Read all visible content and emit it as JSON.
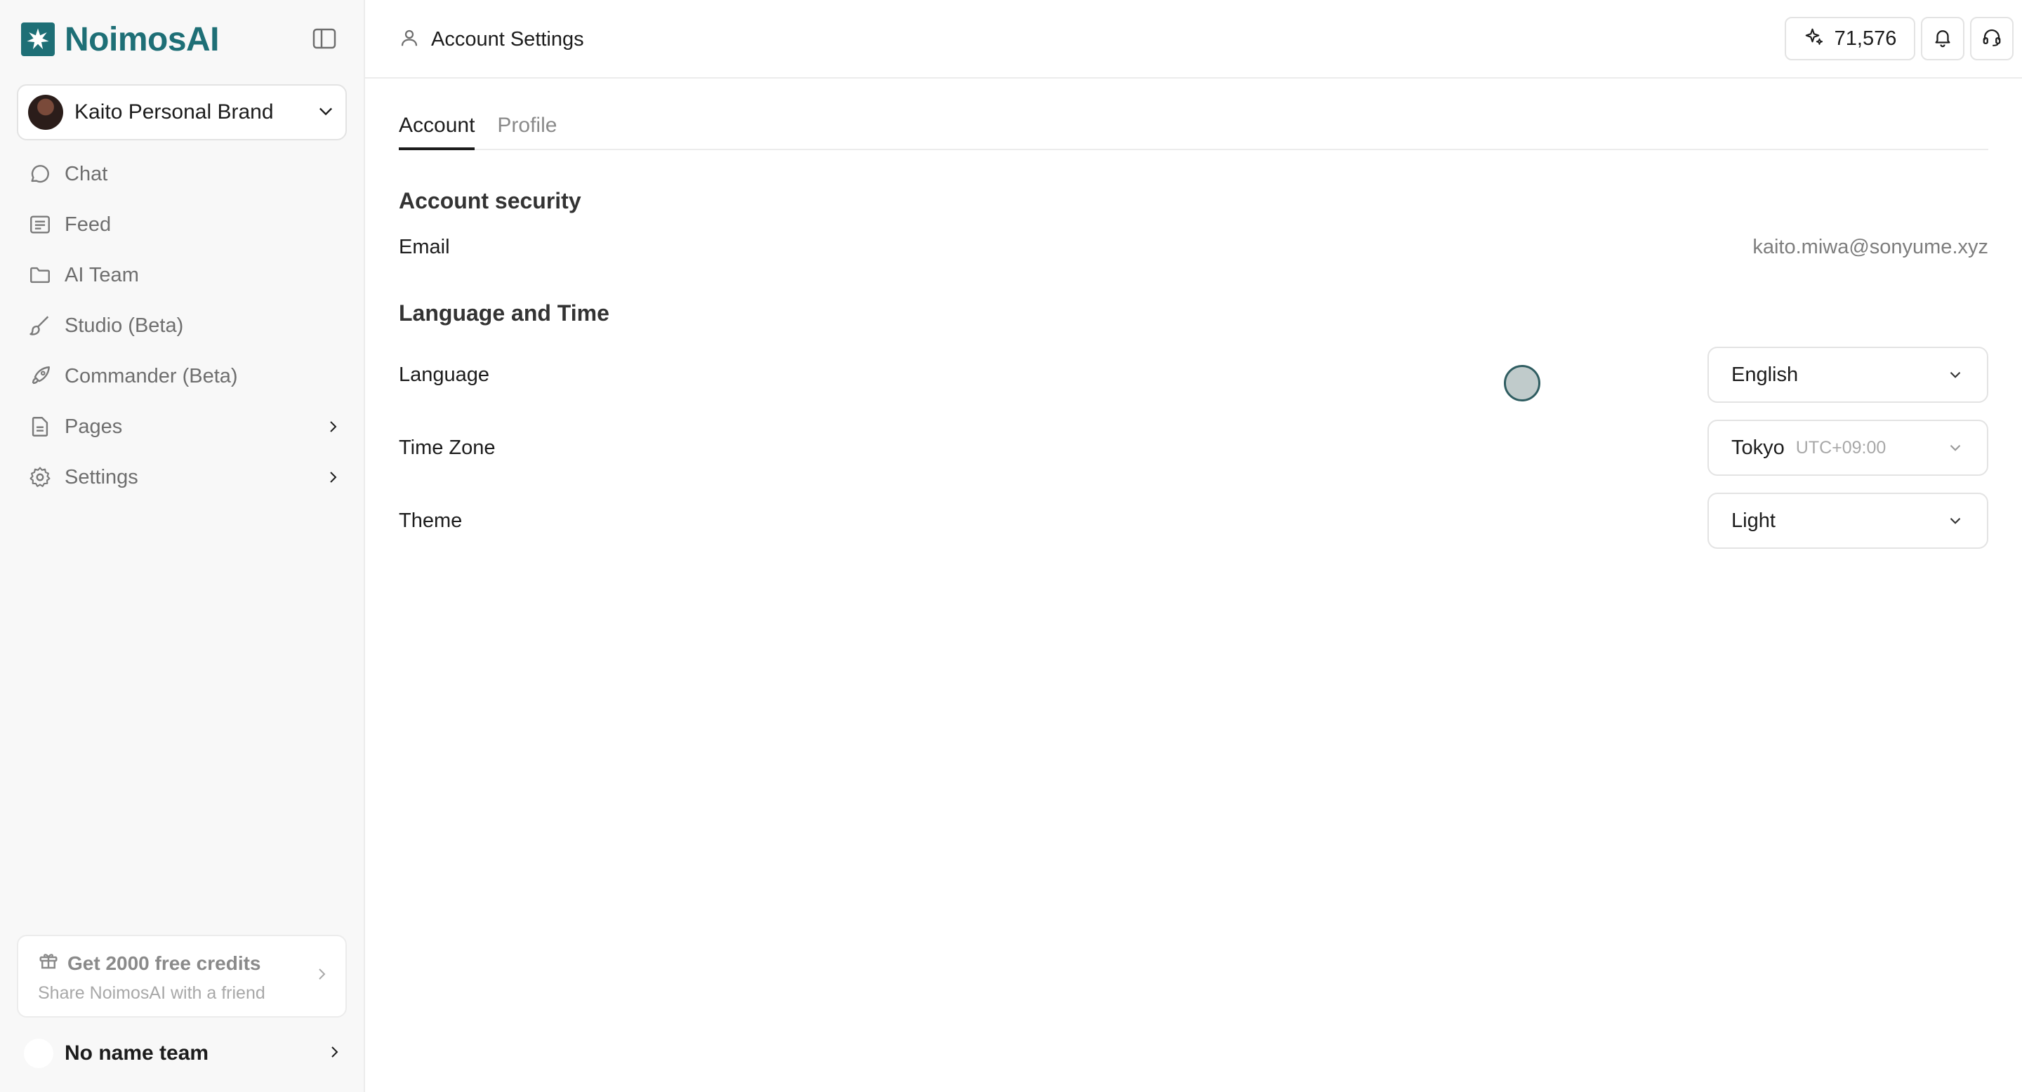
{
  "brand": {
    "name": "NoimosAI",
    "color": "#1e6f76"
  },
  "workspace": {
    "name": "Kaito Personal Brand"
  },
  "sidebar": {
    "items": [
      {
        "label": "Chat",
        "icon": "chat-bubble-icon"
      },
      {
        "label": "Feed",
        "icon": "feed-icon"
      },
      {
        "label": "AI Team",
        "icon": "folder-icon"
      },
      {
        "label": "Studio (Beta)",
        "icon": "brush-icon"
      },
      {
        "label": "Commander (Beta)",
        "icon": "rocket-icon"
      },
      {
        "label": "Pages",
        "icon": "document-icon",
        "expandable": true
      },
      {
        "label": "Settings",
        "icon": "gear-icon",
        "expandable": true
      }
    ],
    "referral": {
      "title": "Get 2000 free credits",
      "subtitle": "Share NoimosAI with a friend"
    },
    "team": {
      "name": "No name team"
    }
  },
  "header": {
    "title": "Account Settings",
    "credits": "71,576"
  },
  "tabs": [
    {
      "label": "Account",
      "active": true
    },
    {
      "label": "Profile",
      "active": false
    }
  ],
  "account_security": {
    "title": "Account security",
    "email_label": "Email",
    "email_value": "kaito.miwa@sonyume.xyz"
  },
  "language_time": {
    "title": "Language and Time",
    "language_label": "Language",
    "language_value": "English",
    "timezone_label": "Time Zone",
    "timezone_value": "Tokyo",
    "timezone_offset": "UTC+09:00",
    "theme_label": "Theme",
    "theme_value": "Light"
  }
}
